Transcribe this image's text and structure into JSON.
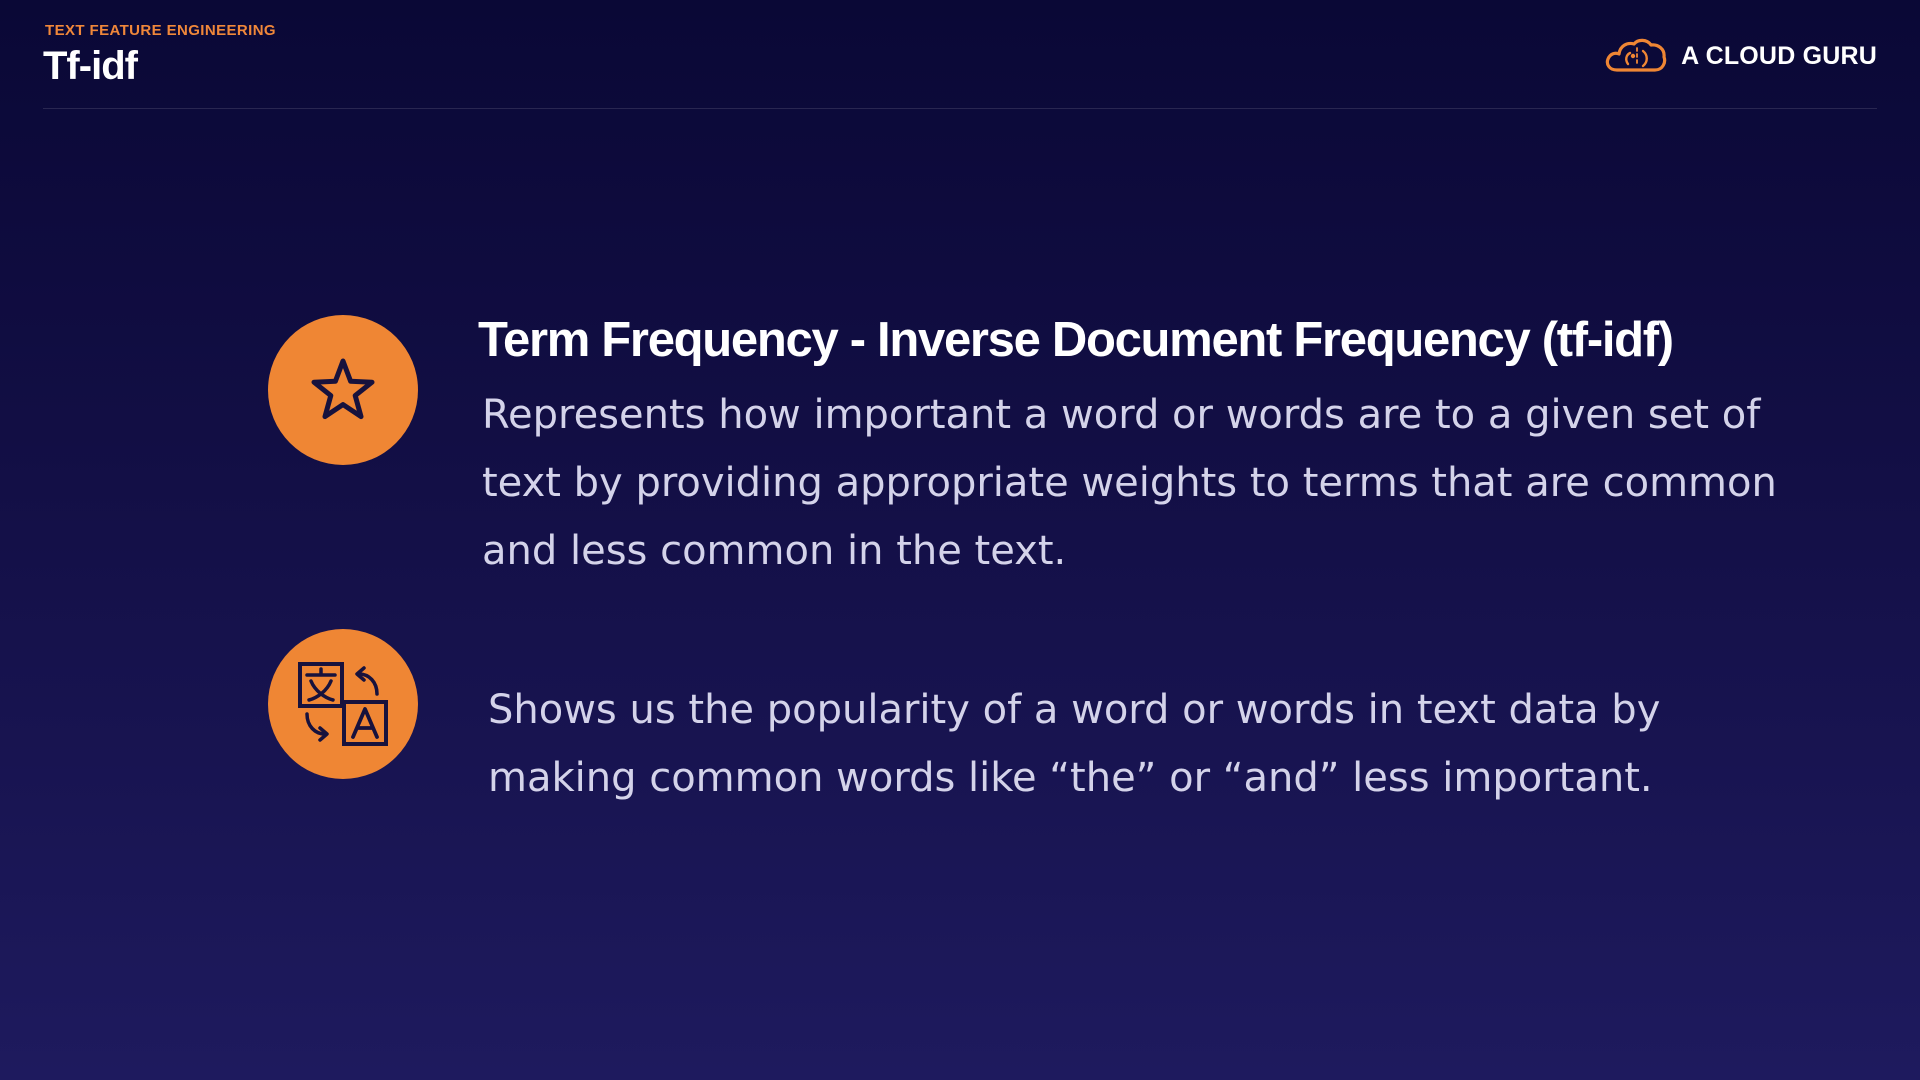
{
  "header": {
    "section_label": "TEXT FEATURE ENGINEERING",
    "title": "Tf-idf",
    "brand_name": "A CLOUD GURU"
  },
  "content": {
    "items": [
      {
        "icon": "star-icon",
        "heading": "Term Frequency - Inverse Document Frequency (tf-idf)",
        "body": "Represents how important a word or words are to a given set of text by providing appropriate weights to terms that are common and less common in the text."
      },
      {
        "icon": "translate-icon",
        "body": "Shows us the popularity of a word or words in text data by making common words like “the” or “and” less important."
      }
    ]
  },
  "colors": {
    "accent": "#ef8634",
    "background_top": "#0a0836",
    "background_bottom": "#1e1a5e",
    "body_text": "#d4d3ea"
  }
}
